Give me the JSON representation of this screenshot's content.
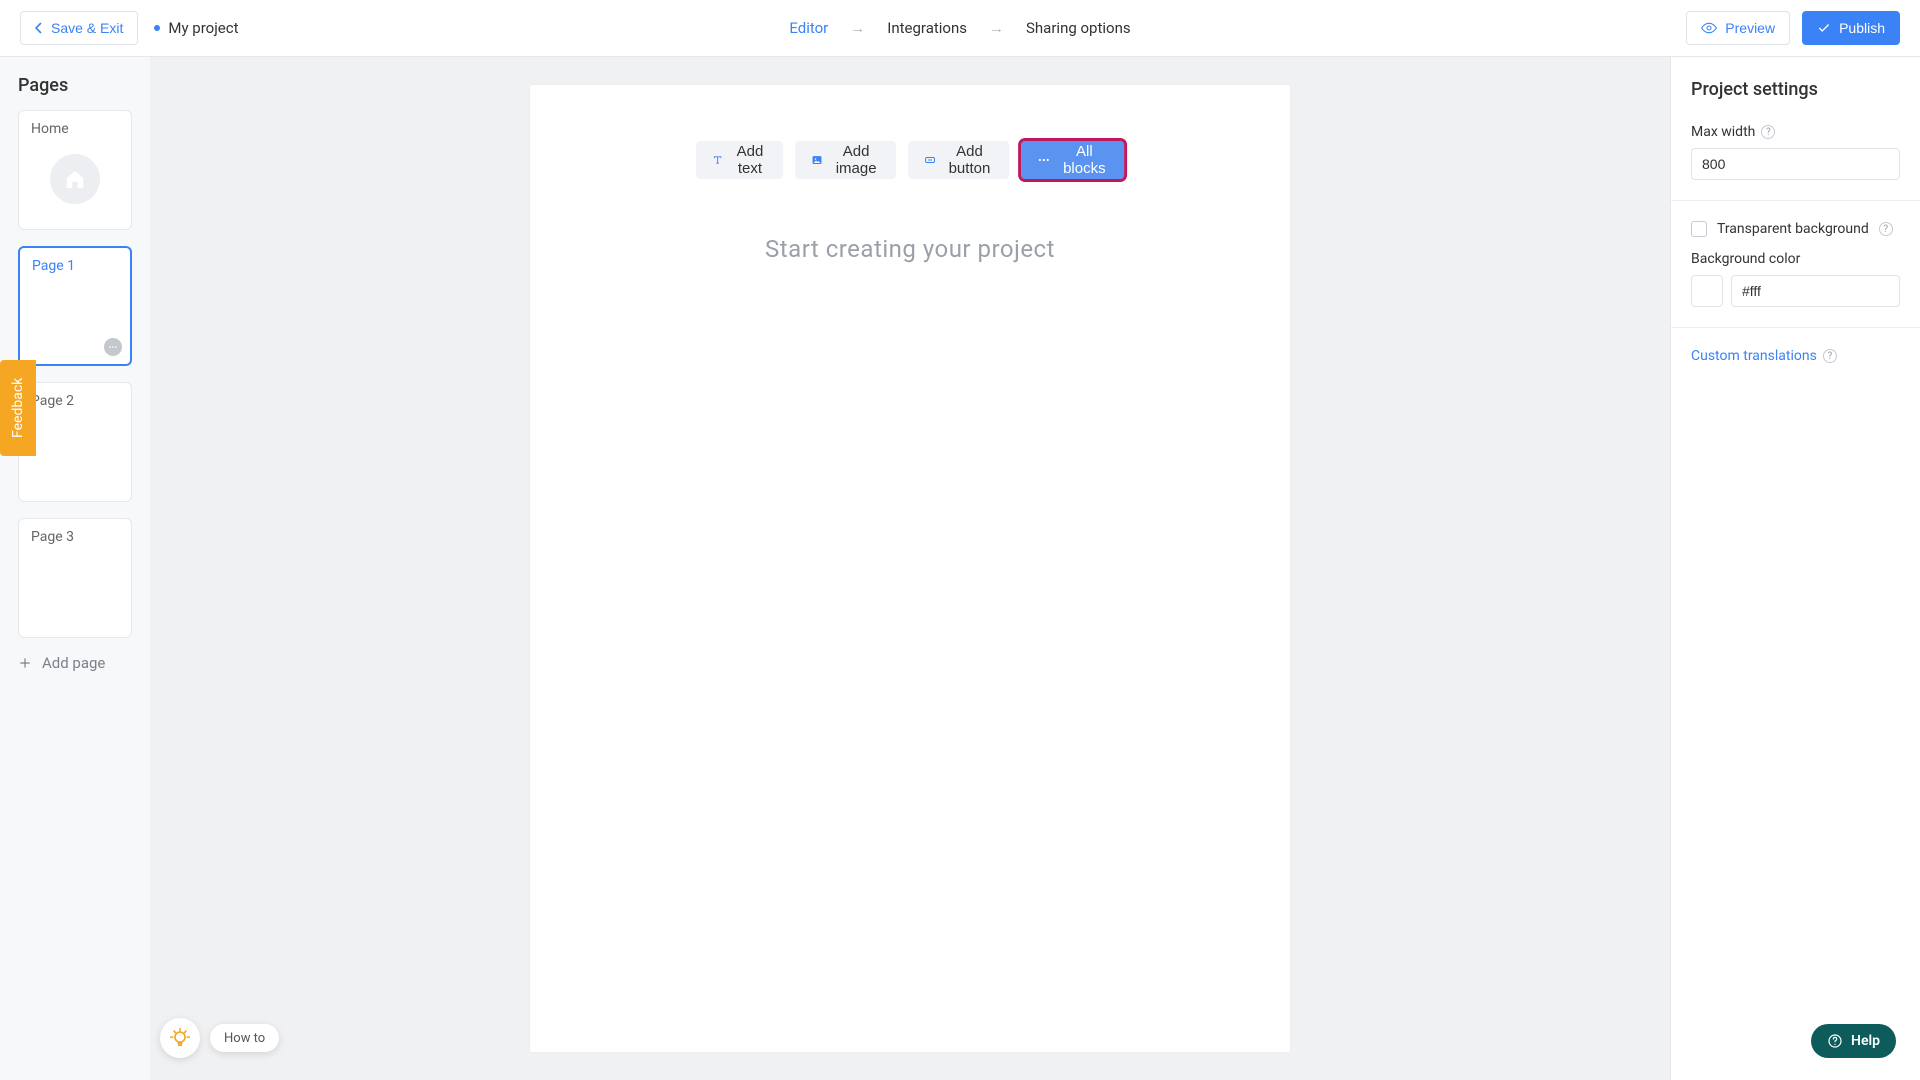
{
  "topbar": {
    "save_exit": "Save & Exit",
    "project_name": "My project",
    "crumbs": {
      "editor": "Editor",
      "integrations": "Integrations",
      "sharing": "Sharing options"
    },
    "preview": "Preview",
    "publish": "Publish"
  },
  "sidebar": {
    "title": "Pages",
    "pages": [
      {
        "label": "Home"
      },
      {
        "label": "Page 1"
      },
      {
        "label": "Page 2"
      },
      {
        "label": "Page 3"
      }
    ],
    "add_page": "Add page"
  },
  "toolbar": {
    "add_text": "Add text",
    "add_image": "Add image",
    "add_button": "Add button",
    "all_blocks": "All blocks"
  },
  "canvas": {
    "placeholder": "Start creating your project"
  },
  "panel": {
    "title": "Project settings",
    "max_width_label": "Max width",
    "max_width_value": "800",
    "transparent_bg_label": "Transparent background",
    "bg_color_label": "Background color",
    "bg_color_value": "#fff",
    "custom_translations": "Custom translations"
  },
  "feedback": "Feedback",
  "howto": "How to",
  "help": "Help"
}
